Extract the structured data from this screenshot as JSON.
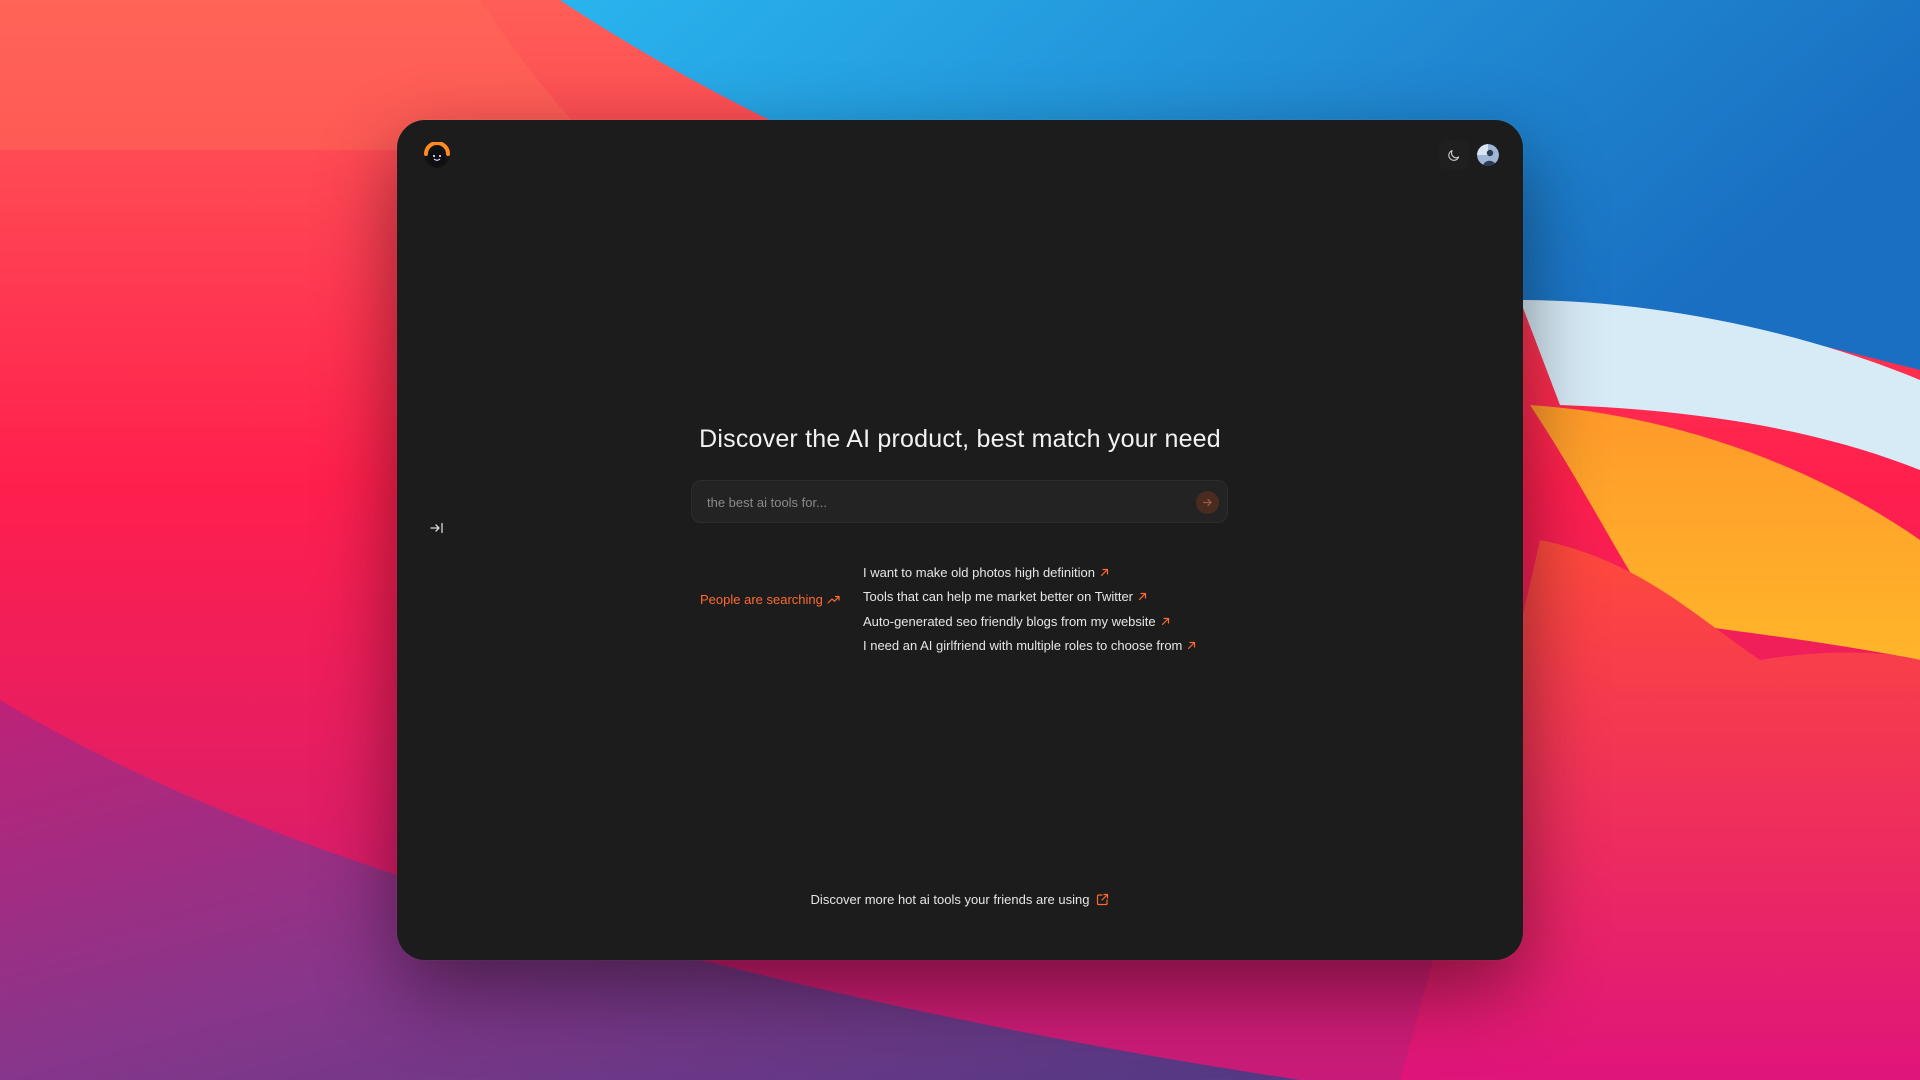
{
  "header": {
    "logo_icon": "smiley-sun-logo-icon",
    "theme_toggle_icon": "moon-icon",
    "avatar_icon": "user-avatar-icon"
  },
  "sidebar": {
    "toggle_icon": "expand-sidebar-icon"
  },
  "main": {
    "headline": "Discover the AI product, best match your need",
    "search": {
      "value": "",
      "placeholder": "the best ai tools for...",
      "send_icon": "arrow-right-icon"
    },
    "trending": {
      "label": "People are searching",
      "icon": "trending-up-icon",
      "items": [
        {
          "text": "I want to make old photos high definition",
          "icon": "arrow-up-right-icon"
        },
        {
          "text": "Tools that can help me market better on Twitter",
          "icon": "arrow-up-right-icon"
        },
        {
          "text": "Auto-generated seo friendly blogs from my website",
          "icon": "arrow-up-right-icon"
        },
        {
          "text": "I need an AI girlfriend with multiple roles to choose from",
          "icon": "arrow-up-right-icon"
        }
      ]
    },
    "footer": {
      "text": "Discover more hot ai tools your friends are using",
      "icon": "external-link-icon"
    }
  },
  "colors": {
    "accent": "#ff6a2f",
    "window_bg": "#1c1c1c",
    "text": "#e6e6e6"
  }
}
